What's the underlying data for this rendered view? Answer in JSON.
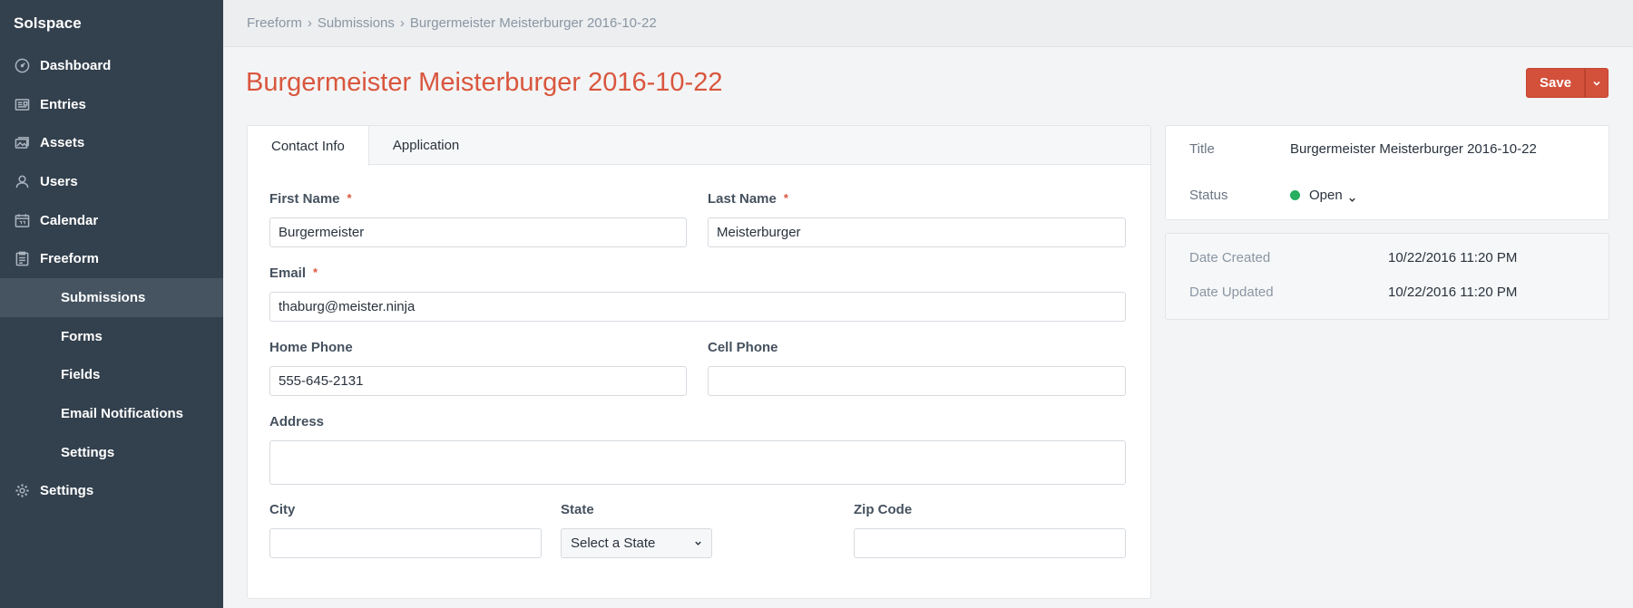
{
  "brand": "Solspace",
  "sidebar": {
    "items": [
      {
        "label": "Dashboard",
        "icon": "dashboard-icon"
      },
      {
        "label": "Entries",
        "icon": "entries-icon"
      },
      {
        "label": "Assets",
        "icon": "assets-icon"
      },
      {
        "label": "Users",
        "icon": "users-icon"
      },
      {
        "label": "Calendar",
        "icon": "calendar-icon"
      },
      {
        "label": "Freeform",
        "icon": "freeform-icon"
      },
      {
        "label": "Submissions",
        "sub": true,
        "active": true
      },
      {
        "label": "Forms",
        "sub": true
      },
      {
        "label": "Fields",
        "sub": true
      },
      {
        "label": "Email Notifications",
        "sub": true
      },
      {
        "label": "Settings",
        "sub": true
      },
      {
        "label": "Settings",
        "icon": "gear-icon"
      }
    ]
  },
  "breadcrumb": {
    "items": [
      "Freeform",
      "Submissions",
      "Burgermeister Meisterburger 2016-10-22"
    ],
    "separator": "›"
  },
  "page": {
    "title": "Burgermeister Meisterburger 2016-10-22",
    "save_label": "Save"
  },
  "tabs": [
    {
      "label": "Contact Info",
      "active": true
    },
    {
      "label": "Application",
      "active": false
    }
  ],
  "form": {
    "first_name": {
      "label": "First Name",
      "value": "Burgermeister",
      "required": "*"
    },
    "last_name": {
      "label": "Last Name",
      "value": "Meisterburger",
      "required": "*"
    },
    "email": {
      "label": "Email",
      "value": "thaburg@meister.ninja",
      "required": "*"
    },
    "home_phone": {
      "label": "Home Phone",
      "value": "555-645-2131"
    },
    "cell_phone": {
      "label": "Cell Phone",
      "value": ""
    },
    "address": {
      "label": "Address",
      "value": ""
    },
    "city": {
      "label": "City",
      "value": ""
    },
    "state": {
      "label": "State",
      "value": "Select a State"
    },
    "zip": {
      "label": "Zip Code",
      "value": ""
    }
  },
  "meta": {
    "title_label": "Title",
    "title_value": "Burgermeister Meisterburger 2016-10-22",
    "status_label": "Status",
    "status_value": "Open",
    "status_color": "#27ae60"
  },
  "dates": {
    "created_label": "Date Created",
    "created_value": "10/22/2016 11:20 PM",
    "updated_label": "Date Updated",
    "updated_value": "10/22/2016 11:20 PM"
  },
  "colors": {
    "accent": "#d9563e",
    "sidebar": "#33404d",
    "sidebar_active": "#465461"
  }
}
